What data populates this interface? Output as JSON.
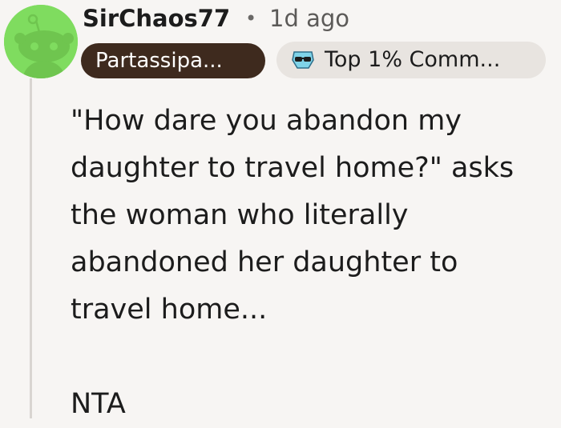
{
  "comment": {
    "author": "SirChaos77",
    "separator": "•",
    "timestamp": "1d ago",
    "flair": "Partassipa...",
    "badge": {
      "label": "Top 1% Comm...",
      "icon": "sunglasses-badge-icon"
    },
    "body_lines": [
      "\"How dare you abandon my",
      "daughter to travel home?\" asks",
      "the woman who literally",
      "abandoned her daughter to",
      "travel home..."
    ],
    "verdict": "NTA"
  },
  "colors": {
    "avatar_bg": "#7fdc5f",
    "flair_bg": "#3e2a1e",
    "badge_bg": "#e8e4e0",
    "page_bg": "#f7f5f3"
  }
}
